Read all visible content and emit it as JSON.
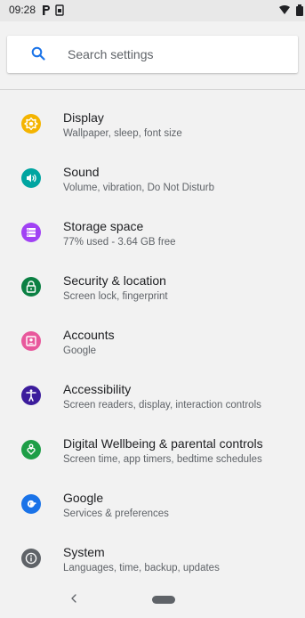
{
  "status_bar": {
    "time": "09:28",
    "icons": [
      "parking-icon",
      "sim-card-icon",
      "wifi-icon",
      "battery-icon"
    ]
  },
  "search": {
    "placeholder": "Search settings",
    "icon": "search-icon",
    "accent": "#1a73e8"
  },
  "settings": {
    "items": [
      {
        "title": "Display",
        "subtitle": "Wallpaper, sleep, font size",
        "icon": "brightness-icon",
        "color": "#f4b400"
      },
      {
        "title": "Sound",
        "subtitle": "Volume, vibration, Do Not Disturb",
        "icon": "volume-icon",
        "color": "#00a5a1"
      },
      {
        "title": "Storage space",
        "subtitle": "77% used - 3.64 GB free",
        "icon": "storage-icon",
        "color": "#a142f4"
      },
      {
        "title": "Security & location",
        "subtitle": "Screen lock, fingerprint",
        "icon": "lock-icon",
        "color": "#0b8043"
      },
      {
        "title": "Accounts",
        "subtitle": "Google",
        "icon": "account-icon",
        "color": "#e8589c"
      },
      {
        "title": "Accessibility",
        "subtitle": "Screen readers, display, interaction controls",
        "icon": "accessibility-icon",
        "color": "#3c1c9c"
      },
      {
        "title": "Digital Wellbeing & parental controls",
        "subtitle": "Screen time, app timers, bedtime schedules",
        "icon": "wellbeing-icon",
        "color": "#1e9e47"
      },
      {
        "title": "Google",
        "subtitle": "Services & preferences",
        "icon": "google-icon",
        "color": "#1a73e8"
      },
      {
        "title": "System",
        "subtitle": "Languages, time, backup, updates",
        "icon": "info-icon",
        "color": "#5f6368"
      }
    ]
  },
  "nav_bar": {
    "back_icon": "back-chevron-icon",
    "home_icon": "home-pill-icon"
  }
}
